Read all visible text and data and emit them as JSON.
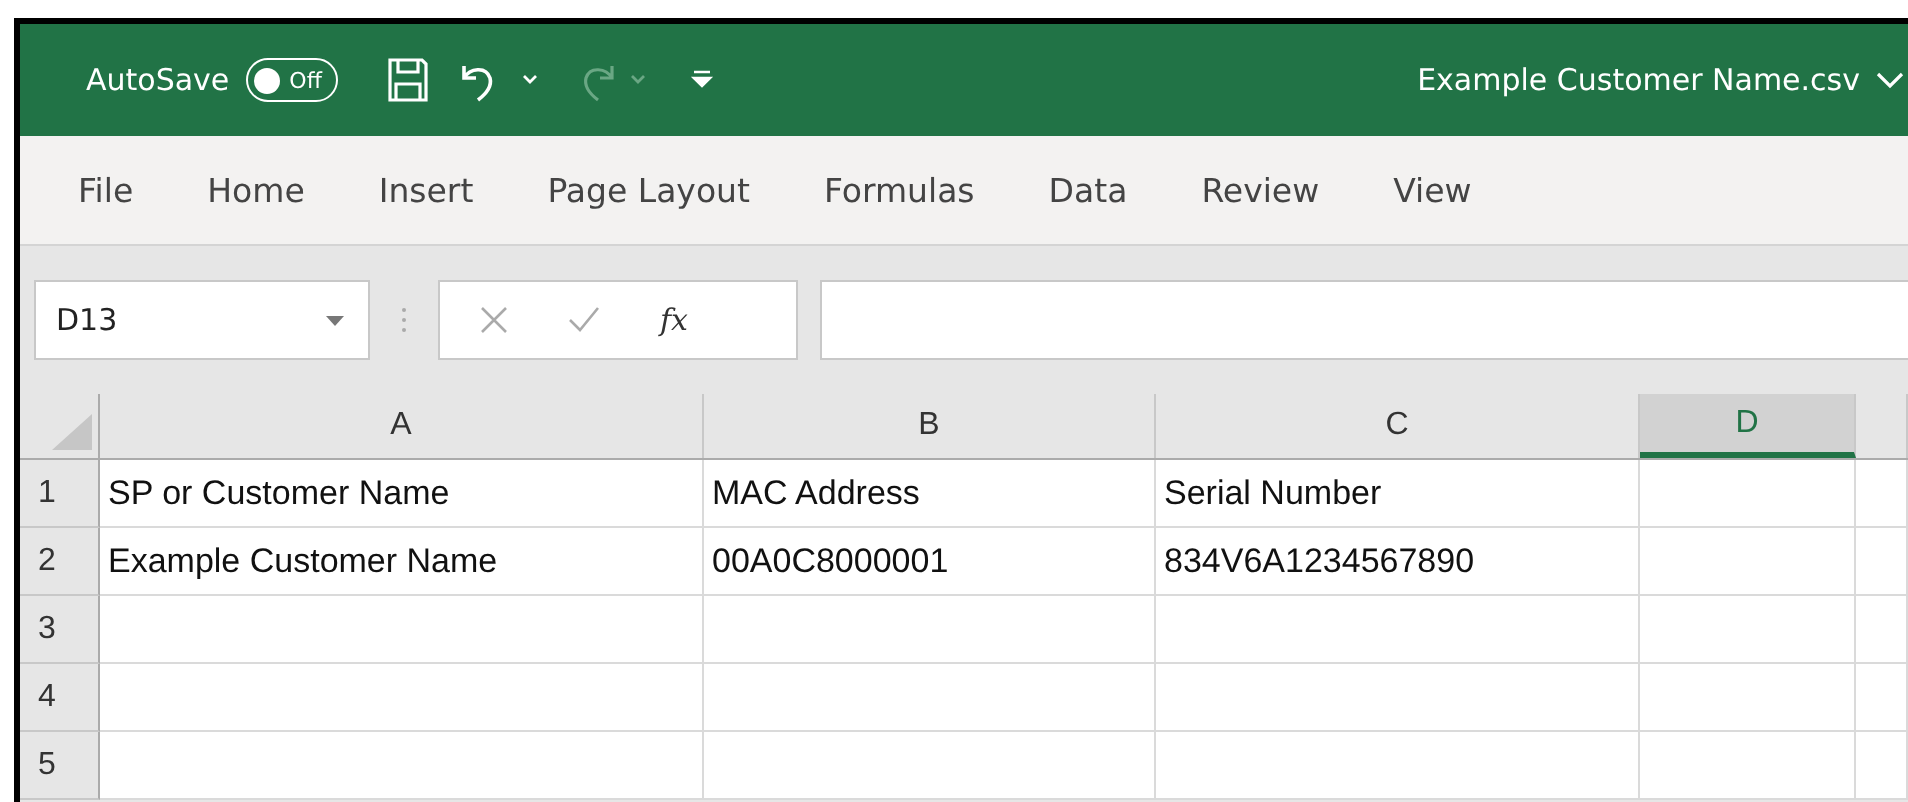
{
  "title_bar": {
    "autosave_label": "AutoSave",
    "autosave": {
      "on": false,
      "label": "Off"
    },
    "file_name": "Example Customer Name.csv"
  },
  "ribbon_tabs": [
    {
      "label": "File",
      "selected": false
    },
    {
      "label": "Home",
      "selected": false
    },
    {
      "label": "Insert",
      "selected": false
    },
    {
      "label": "Page Layout",
      "selected": false
    },
    {
      "label": "Formulas",
      "selected": false
    },
    {
      "label": "Data",
      "selected": false
    },
    {
      "label": "Review",
      "selected": false
    },
    {
      "label": "View",
      "selected": false
    }
  ],
  "formula_bar": {
    "name_box": "D13",
    "function_label": "fx"
  },
  "sheet": {
    "columns": [
      {
        "label": "A",
        "selected": false
      },
      {
        "label": "B",
        "selected": false
      },
      {
        "label": "C",
        "selected": false
      },
      {
        "label": "D",
        "selected": true
      }
    ],
    "rows": [
      {
        "number": "1",
        "cells": [
          "SP or Customer Name",
          "MAC Address",
          "Serial Number",
          ""
        ]
      },
      {
        "number": "2",
        "cells": [
          "Example Customer Name",
          "00A0C8000001",
          "834V6A1234567890",
          ""
        ]
      },
      {
        "number": "3",
        "cells": [
          "",
          "",
          "",
          ""
        ]
      },
      {
        "number": "4",
        "cells": [
          "",
          "",
          "",
          ""
        ]
      },
      {
        "number": "5",
        "cells": [
          "",
          "",
          "",
          ""
        ]
      }
    ]
  }
}
